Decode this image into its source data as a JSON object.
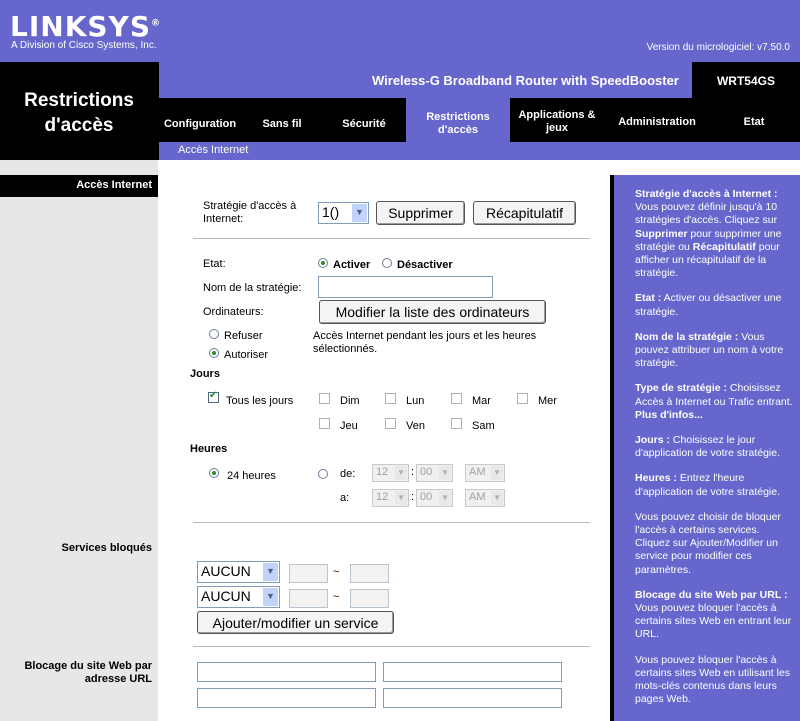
{
  "brand": {
    "logo": "LINKSYS",
    "reg_mark": "®",
    "tagline": "A Division of Cisco Systems, Inc."
  },
  "firmware_version": "Version du micrologiciel: v7.50.0",
  "section_title": "Restrictions d'accès",
  "product_name": "Wireless-G Broadband Router with SpeedBooster",
  "model": "WRT54GS",
  "tabs": [
    "Configuration",
    "Sans fil",
    "Sécurité",
    "Restrictions d'accès",
    "Applications & jeux",
    "Administration",
    "Etat"
  ],
  "subnav": "Accès Internet",
  "left_labels": {
    "access": "Accès Internet",
    "blocked_services": "Services bloqués",
    "web_block": "Blocage du site Web par adresse URL"
  },
  "policy": {
    "label": "Stratégie d'accès à Internet:",
    "selected": "1()",
    "delete_button": "Supprimer",
    "summary_button": "Récapitulatif"
  },
  "status": {
    "label": "Etat:",
    "enable": "Activer",
    "disable": "Désactiver",
    "selected": "Activer"
  },
  "policy_name": {
    "label": "Nom de la stratégie:",
    "value": ""
  },
  "computers": {
    "label": "Ordinateurs:",
    "button": "Modifier la liste des ordinateurs"
  },
  "access_mode": {
    "deny": "Refuser",
    "allow": "Autoriser",
    "selected": "Autoriser",
    "description": "Accès Internet pendant les jours et les heures sélectionnés."
  },
  "days": {
    "label": "Jours",
    "every_day": "Tous les jours",
    "every_day_checked": true,
    "items": [
      "Dim",
      "Lun",
      "Mar",
      "Mer",
      "Jeu",
      "Ven",
      "Sam"
    ]
  },
  "hours": {
    "label": "Heures",
    "all_day": "24 heures",
    "from_label": "de:",
    "to_label": "a:",
    "from": {
      "hour": "12",
      "minute": "00",
      "ampm": "AM"
    },
    "to": {
      "hour": "12",
      "minute": "00",
      "ampm": "AM"
    }
  },
  "services": {
    "rows": [
      {
        "value": "AUCUN",
        "tilde": "~"
      },
      {
        "value": "AUCUN",
        "tilde": "~"
      }
    ],
    "button": "Ajouter/modifier un service"
  },
  "help": [
    {
      "title": "Stratégie d'accès à Internet :",
      "text": "Vous pouvez définir jusqu'à 10 stratégies d'accès. Cliquez sur ",
      "b1": "Supprimer",
      "t2": " pour supprimer une stratégie ou ",
      "b2": "Récapitulatif",
      "t3": " pour afficher un récapitulatif de la stratégie."
    },
    {
      "title": "Etat :",
      "text": " Activer ou désactiver une stratégie."
    },
    {
      "title": "Nom de la stratégie :",
      "text": " Vous pouvez attribuer un nom à votre stratégie."
    },
    {
      "title": "Type de stratégie :",
      "text": " Choisissez Accès à Internet ou Trafic entrant.",
      "more": "Plus d'infos..."
    },
    {
      "title": "Jours :",
      "text": " Choisissez le jour d'application de votre stratégie."
    },
    {
      "title": "Heures :",
      "text": " Entrez l'heure d'application de votre stratégie."
    },
    {
      "title": "",
      "text": "Vous pouvez choisir de bloquer l'accès à certains services. Cliquez sur Ajouter/Modifier un service pour modifier ces paramètres."
    },
    {
      "title": "Blocage du site Web par URL :",
      "text": " Vous pouvez bloquer l'accès à certains sites Web en entrant leur URL."
    },
    {
      "title": "",
      "text": "Vous pouvez bloquer l'accès à certains sites Web en utilisant les mots-clés contenus dans leurs pages Web."
    }
  ],
  "colors": {
    "brand_purple": "#6666cc",
    "black": "#000000",
    "left_gray": "#e7e7e7"
  }
}
